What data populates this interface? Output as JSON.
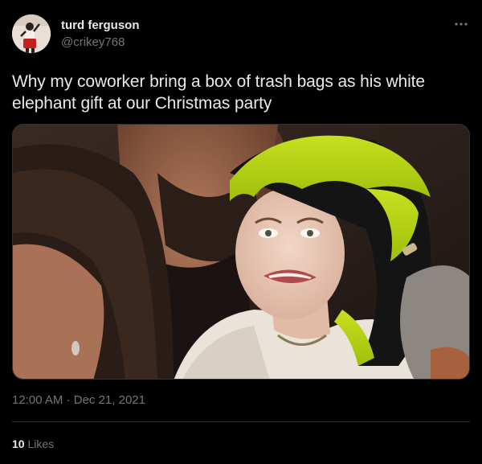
{
  "author": {
    "display_name": "turd ferguson",
    "handle": "@crikey768"
  },
  "tweet": {
    "text": "Why my coworker bring a box of trash bags as his white elephant gift at our Christmas party",
    "time": "12:00 AM",
    "separator": " · ",
    "date": "Dec 21, 2021"
  },
  "stats": {
    "likes_count": "10",
    "likes_label": " Likes"
  },
  "icons": {
    "more": "more-horizontal-icon"
  },
  "colors": {
    "background": "#000000",
    "text_primary": "#e7e9ea",
    "text_secondary": "#71767b",
    "border": "#2f3336",
    "hair_green": "#b5d417"
  }
}
